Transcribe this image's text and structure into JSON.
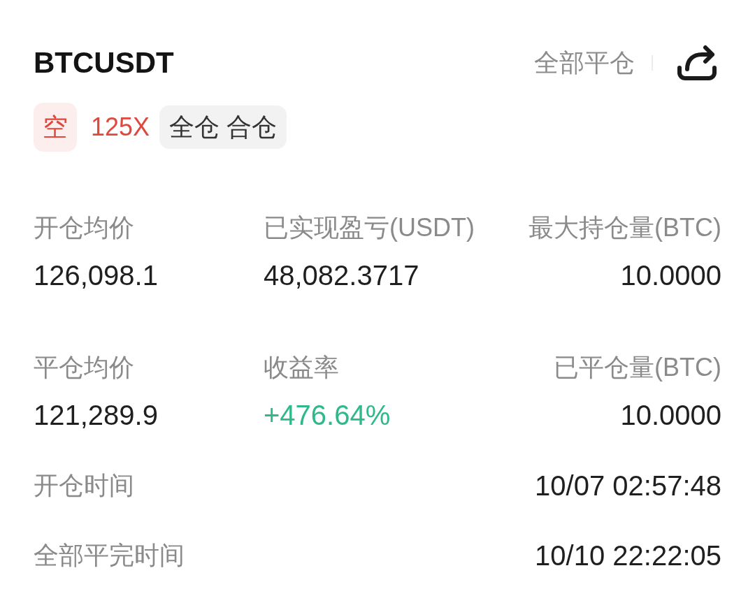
{
  "header": {
    "symbol": "BTCUSDT",
    "close_all_button": "全部平仓"
  },
  "tags": [
    {
      "kind": "side",
      "text": "空"
    },
    {
      "kind": "leverage",
      "text": "125X"
    },
    {
      "kind": "margin",
      "text": "全仓 合仓"
    }
  ],
  "stats": [
    {
      "label": "开仓均价",
      "value": "126,098.1",
      "kind": "plain"
    },
    {
      "label": "已实现盈亏(USDT)",
      "value": "48,082.3717",
      "kind": "plain"
    },
    {
      "label": "最大持仓量(BTC)",
      "value": "10.0000",
      "kind": "plain"
    },
    {
      "label": "平仓均价",
      "value": "121,289.9",
      "kind": "plain"
    },
    {
      "label": "收益率",
      "value": "+476.64%",
      "kind": "gain"
    },
    {
      "label": "已平仓量(BTC)",
      "value": "10.0000",
      "kind": "plain"
    }
  ],
  "details": [
    {
      "label": "开仓时间",
      "value": "10/07 02:57:48"
    },
    {
      "label": "全部平完时间",
      "value": "10/10 22:22:05"
    }
  ]
}
